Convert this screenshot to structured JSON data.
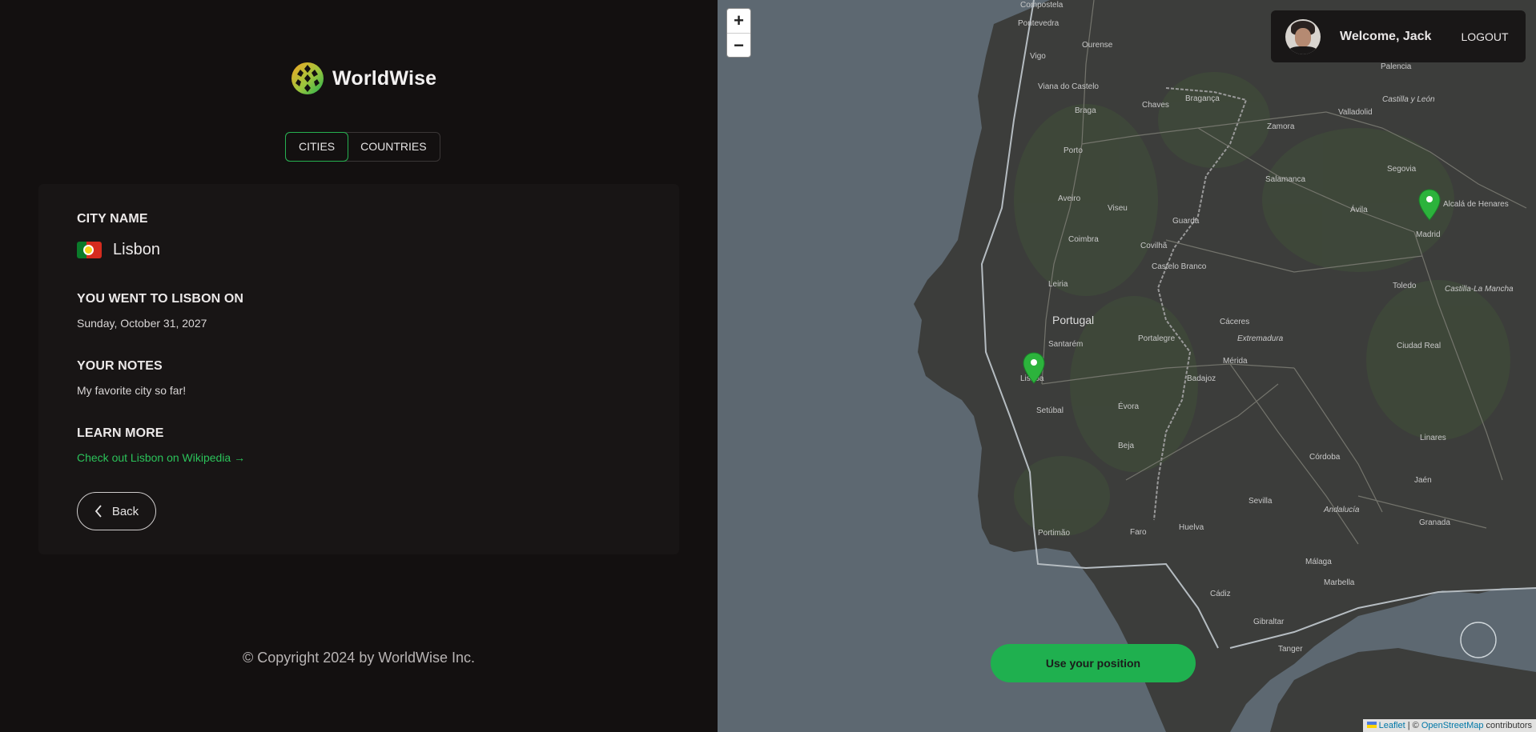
{
  "app": {
    "name": "WorldWise"
  },
  "tabs": [
    {
      "label": "Cities",
      "active": true
    },
    {
      "label": "Countries",
      "active": false
    }
  ],
  "city": {
    "name_label": "City name",
    "name": "Lisbon",
    "flag": "portugal-flag",
    "visited_label": "You went to Lisbon on",
    "visited_date": "Sunday, October 31, 2027",
    "notes_label": "Your notes",
    "notes": "My favorite city so far!",
    "learn_label": "Learn more",
    "wiki_link": "Check out Lisbon on Wikipedia →",
    "back_label": "Back"
  },
  "footer": {
    "copyright": "© Copyright 2024 by WorldWise Inc."
  },
  "map": {
    "zoom_in": "+",
    "zoom_out": "−",
    "user": {
      "welcome": "Welcome, Jack",
      "logout": "Logout"
    },
    "use_position": "Use your position",
    "attribution": {
      "leaflet": "Leaflet",
      "sep": " | © ",
      "osm": "OpenStreetMap",
      "suffix": " contributors"
    },
    "accent": "#1fb04f",
    "labels": [
      {
        "text": "Compostela"
      },
      {
        "text": "Pontevedra"
      },
      {
        "text": "Ourense"
      },
      {
        "text": "Vigo"
      },
      {
        "text": "Viana do Castelo"
      },
      {
        "text": "Braga"
      },
      {
        "text": "Bragança"
      },
      {
        "text": "Chaves"
      },
      {
        "text": "Palencia"
      },
      {
        "text": "Castilla y León"
      },
      {
        "text": "Valladolid"
      },
      {
        "text": "Zamora"
      },
      {
        "text": "Porto"
      },
      {
        "text": "Salamanca"
      },
      {
        "text": "Segovia"
      },
      {
        "text": "Ávila"
      },
      {
        "text": "Alcalá de Henares"
      },
      {
        "text": "Madrid"
      },
      {
        "text": "Aveiro"
      },
      {
        "text": "Viseu"
      },
      {
        "text": "Guarda"
      },
      {
        "text": "Coimbra"
      },
      {
        "text": "Covilhã"
      },
      {
        "text": "Toledo"
      },
      {
        "text": "Castilla-La Mancha"
      },
      {
        "text": "Leiria"
      },
      {
        "text": "Castelo Branco"
      },
      {
        "text": "Portugal"
      },
      {
        "text": "Cáceres"
      },
      {
        "text": "Extremadura"
      },
      {
        "text": "Ciudad Real"
      },
      {
        "text": "Lisboa"
      },
      {
        "text": "Santarém"
      },
      {
        "text": "Portalegre"
      },
      {
        "text": "Mérida"
      },
      {
        "text": "Badajoz"
      },
      {
        "text": "Setúbal"
      },
      {
        "text": "Évora"
      },
      {
        "text": "Beja"
      },
      {
        "text": "Linares"
      },
      {
        "text": "Jaén"
      },
      {
        "text": "Córdoba"
      },
      {
        "text": "Sevilla"
      },
      {
        "text": "Andalucía"
      },
      {
        "text": "Granada"
      },
      {
        "text": "Faro"
      },
      {
        "text": "Huelva"
      },
      {
        "text": "Portimão"
      },
      {
        "text": "Málaga"
      },
      {
        "text": "Marbella"
      },
      {
        "text": "Cádiz"
      },
      {
        "text": "Gibraltar"
      },
      {
        "text": "Tanger"
      }
    ],
    "markers": [
      {
        "city": "Lisbon"
      },
      {
        "city": "Madrid"
      }
    ]
  }
}
